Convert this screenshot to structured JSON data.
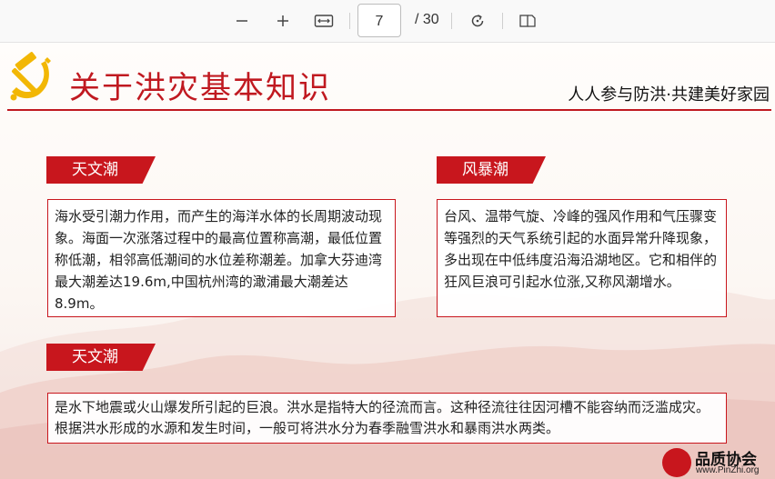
{
  "toolbar": {
    "zoom_out_icon": "minus-icon",
    "zoom_in_icon": "plus-icon",
    "fit_width_icon": "fit-width-icon",
    "page_number": "7",
    "page_total": "/ 30",
    "rotate_icon": "rotate-icon",
    "two_page_icon": "two-page-icon"
  },
  "slide": {
    "title": "关于洪灾基本知识",
    "slogan": "人人参与防洪·共建美好家园",
    "sections": [
      {
        "tag": "天文潮",
        "text": "海水受引潮力作用，而产生的海洋水体的长周期波动现象。海面一次涨落过程中的最高位置称高潮，最低位置称低潮，相邻高低潮间的水位差称潮差。加拿大芬迪湾最大潮差达19.6m,中国杭州湾的澉浦最大潮差达8.9m。"
      },
      {
        "tag": "风暴潮",
        "text": "台风、温带气旋、冷峰的强风作用和气压骤变等强烈的天气系统引起的水面异常升降现象，多出现在中低纬度沿海沿湖地区。它和相伴的狂风巨浪可引起水位涨,又称风潮增水。"
      },
      {
        "tag": "天文潮",
        "text": "是水下地震或火山爆发所引起的巨浪。洪水是指特大的径流而言。这种径流往往因河槽不能容纳而泛滥成灾。根据洪水形成的水源和发生时间，一般可将洪水分为春季融雪洪水和暴雨洪水两类。"
      }
    ],
    "watermark": {
      "name": "品质协会",
      "url": "www.PinZhi.org"
    }
  },
  "colors": {
    "accent": "#c8161d",
    "emblem": "#f2b705"
  }
}
